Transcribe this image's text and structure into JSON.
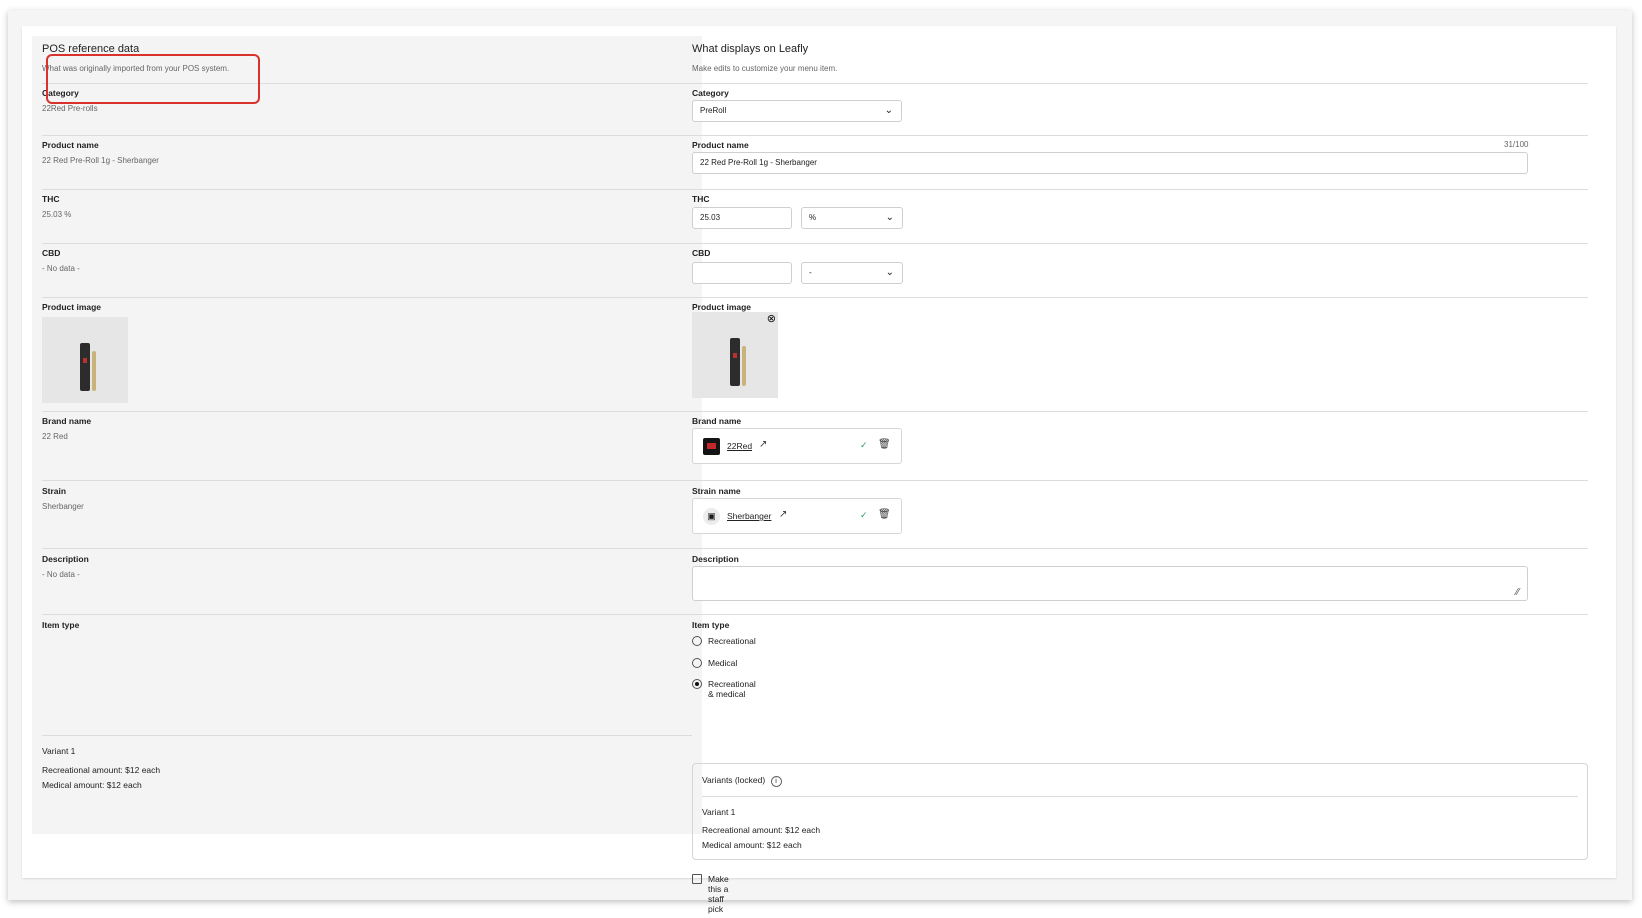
{
  "pos": {
    "title": "POS reference data",
    "subtitle": "What was originally imported from your POS system.",
    "category_label": "Category",
    "category_value": "22Red Pre-rolls",
    "product_name_label": "Product name",
    "product_name_value": "22 Red Pre-Roll 1g - Sherbanger",
    "thc_label": "THC",
    "thc_value": "25.03 %",
    "cbd_label": "CBD",
    "cbd_value": "- No data -",
    "image_label": "Product image",
    "brand_label": "Brand name",
    "brand_value": "22 Red",
    "strain_label": "Strain",
    "strain_value": "Sherbanger",
    "description_label": "Description",
    "description_value": "- No data -",
    "item_type_label": "Item type",
    "variant_title": "Variant 1",
    "variant_rec": "Recreational amount: $12 each",
    "variant_med": "Medical amount: $12 each"
  },
  "leafly": {
    "title": "What displays on Leafly",
    "subtitle": "Make edits to customize your menu item.",
    "category_label": "Category",
    "category_value": "PreRoll",
    "product_name_label": "Product name",
    "product_name_value": "22 Red Pre-Roll 1g - Sherbanger",
    "product_name_count": "31/100",
    "thc_label": "THC",
    "thc_value": "25.03",
    "thc_unit": "%",
    "cbd_label": "CBD",
    "cbd_value": "",
    "cbd_unit": "-",
    "image_label": "Product image",
    "brand_label": "Brand name",
    "brand_value": "22Red",
    "strain_label": "Strain name",
    "strain_value": "Sherbanger",
    "description_label": "Description",
    "description_value": "",
    "item_type_label": "Item type",
    "item_types": [
      "Recreational",
      "Medical",
      "Recreational & medical"
    ],
    "item_type_selected": "Recreational & medical",
    "variants_title": "Variants (locked)",
    "variant_title": "Variant 1",
    "variant_rec": "Recreational amount: $12 each",
    "variant_med": "Medical amount: $12 each",
    "staff_pick_label": "Make this a staff pick"
  },
  "colors": {
    "highlight": "#d9322c",
    "panel_bg": "#f4f4f4"
  },
  "icons": [
    "chevron-down-icon",
    "close-circle-icon",
    "external-link-icon",
    "check-icon",
    "trash-icon",
    "image-placeholder-icon",
    "info-icon",
    "resize-handle-icon"
  ]
}
